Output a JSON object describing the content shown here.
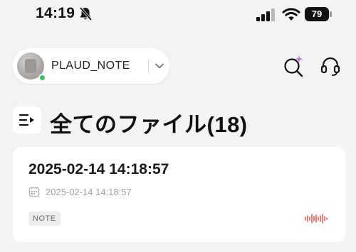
{
  "status_bar": {
    "time": "14:19",
    "battery": "79",
    "icons": [
      "bell-slash-icon",
      "signal-icon",
      "wifi-icon",
      "battery-icon"
    ]
  },
  "header": {
    "device_name": "PLAUD_NOTE",
    "device_status_color": "#34c759",
    "icons": [
      "chevron-down-icon",
      "ai-search-icon",
      "headset-icon"
    ]
  },
  "page": {
    "title": "全てのファイル(18)"
  },
  "files": [
    {
      "title": "2025-02-14 14:18:57",
      "date": "2025-02-14 14:18:57",
      "tag": "NOTE",
      "waveform_color": "#e0463f"
    }
  ]
}
